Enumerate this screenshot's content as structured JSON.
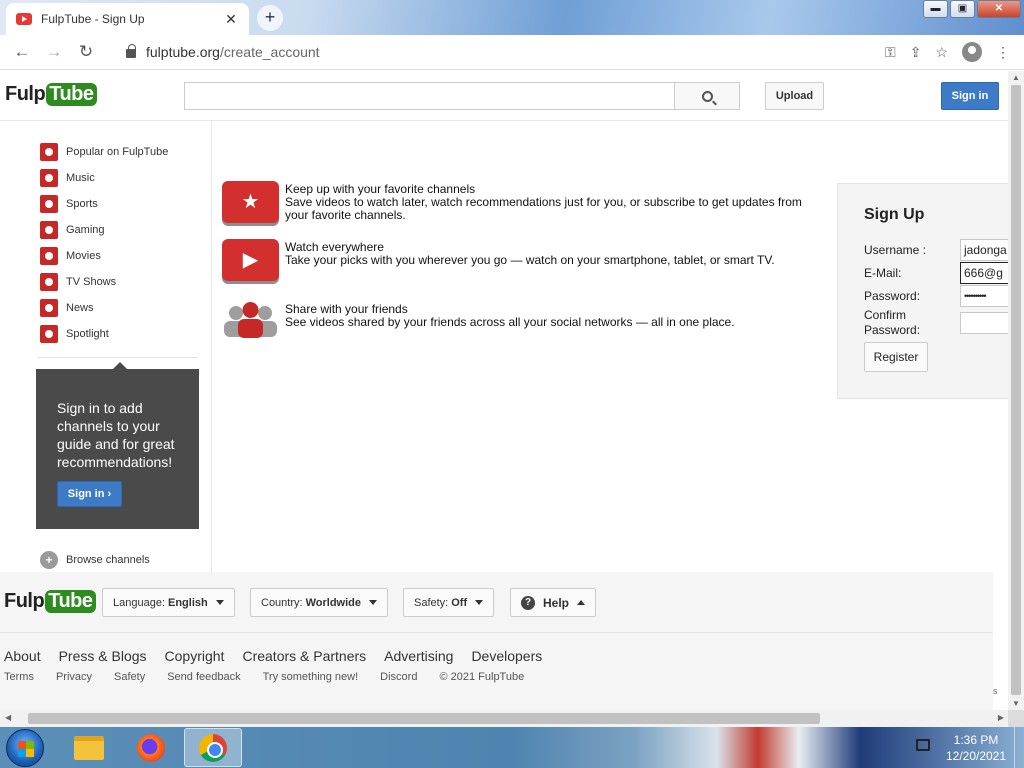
{
  "browser": {
    "tab_title": "FulpTube - Sign Up",
    "tab_close": "✕",
    "new_tab": "+",
    "url_host": "fulptube.org",
    "url_path": "/create_account",
    "win_minimize": "▬",
    "win_restore": "▣",
    "win_close": "✕"
  },
  "site": {
    "logo_part1": "Fulp",
    "logo_part2": "Tube",
    "search_value": "",
    "upload_label": "Upload",
    "signin_label": "Sign in"
  },
  "sidebar": {
    "items": [
      {
        "label": "Popular on FulpTube",
        "icon": "popular-icon"
      },
      {
        "label": "Music",
        "icon": "headphones-icon"
      },
      {
        "label": "Sports",
        "icon": "sports-icon"
      },
      {
        "label": "Gaming",
        "icon": "gamepad-icon"
      },
      {
        "label": "Movies",
        "icon": "film-reel-icon"
      },
      {
        "label": "TV Shows",
        "icon": "tv-icon"
      },
      {
        "label": "News",
        "icon": "newspaper-icon"
      },
      {
        "label": "Spotlight",
        "icon": "spotlight-icon"
      }
    ],
    "promo_text": "Sign in to add channels to your guide and for great recommendations!",
    "promo_button": "Sign in ›",
    "browse_label": "Browse channels"
  },
  "features": [
    {
      "title": "Keep up with your favorite channels",
      "desc": "Save videos to watch later, watch recommendations just for you, or subscribe to get updates from your favorite channels.",
      "icon": "star-tv-icon"
    },
    {
      "title": "Watch everywhere",
      "desc": "Take your picks with you wherever you go — watch on your smartphone, tablet, or smart TV.",
      "icon": "play-devices-icon"
    },
    {
      "title": "Share with your friends",
      "desc": "See videos shared by your friends across all your social networks — all in one place.",
      "icon": "people-icon"
    }
  ],
  "signup": {
    "title": "Sign Up",
    "username_label": "Username :",
    "username_value": "jadonga",
    "email_label": "E-Mail:",
    "email_value": "666@g",
    "password_label": "Password:",
    "password_value": "••••••••••",
    "confirm_label_1": "Confirm",
    "confirm_label_2": "Password:",
    "confirm_value": "",
    "register_label": "Register"
  },
  "footer": {
    "language_label": "Language:",
    "language_value": "English",
    "country_label": "Country:",
    "country_value": "Worldwide",
    "safety_label": "Safety:",
    "safety_value": "Off",
    "help_label": "Help",
    "links": [
      "About",
      "Press & Blogs",
      "Copyright",
      "Creators & Partners",
      "Advertising",
      "Developers"
    ],
    "small_links": [
      "Terms",
      "Privacy",
      "Safety",
      "Send feedback",
      "Try something new!",
      "Discord",
      "© 2021 FulpTube"
    ],
    "side_text": "s"
  },
  "taskbar": {
    "time": "1:36 PM",
    "date": "12/20/2021"
  },
  "colors": {
    "brand_green": "#2e8b1f",
    "accent_blue": "#3d7bc7",
    "brand_red": "#d32f2f"
  }
}
